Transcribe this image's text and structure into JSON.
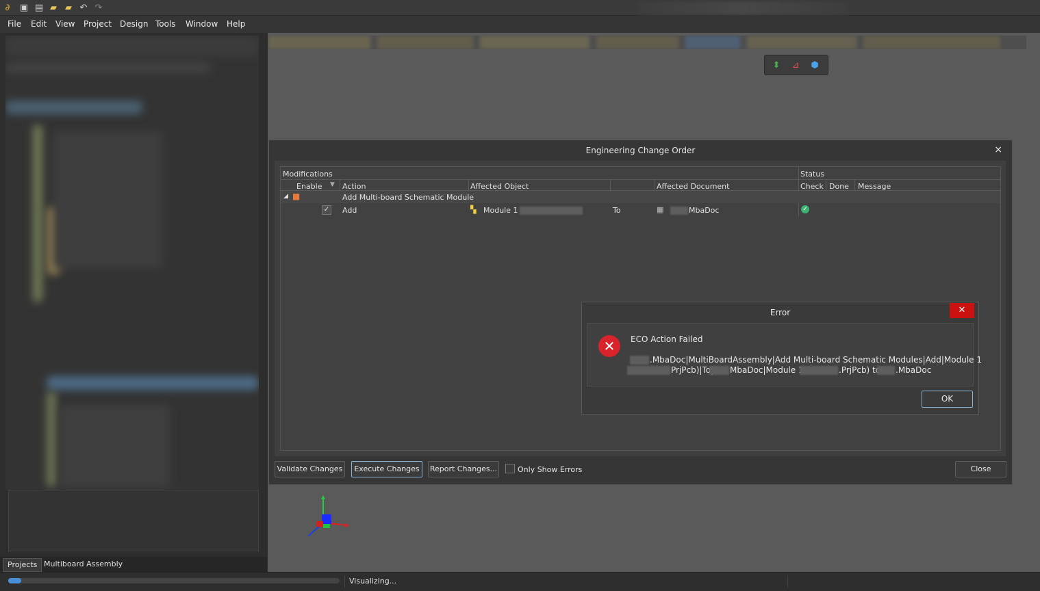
{
  "menu": [
    "File",
    "Edit",
    "View",
    "Project",
    "Design",
    "Tools",
    "Window",
    "Help"
  ],
  "left_tabs": [
    "Projects",
    "Multiboard Assembly"
  ],
  "eco": {
    "title": "Engineering Change Order",
    "close_glyph": "×",
    "group_modifications": "Modifications",
    "group_status": "Status",
    "columns": [
      "Enable",
      "Action",
      "Affected Object",
      "Affected Document",
      "Check",
      "Done",
      "Message"
    ],
    "group_row": {
      "label": "Add Multi-board Schematic Module"
    },
    "row": {
      "action": "Add",
      "object": "Module 1",
      "to": "To",
      "document": "MbaDoc"
    },
    "buttons": {
      "validate": "Validate Changes",
      "execute": "Execute Changes",
      "report": "Report Changes...",
      "close": "Close"
    },
    "only_show_errors": "Only Show Errors"
  },
  "error": {
    "title": "Error",
    "heading": "ECO Action Failed",
    "line1": ".MbaDoc|MultiBoardAssembly|Add Multi-board Schematic Modules|Add|Module 1",
    "line2_a": "PrjPcb)|To|",
    "line2_b": "MbaDoc|Module 1",
    "line2_c": ".PrjPcb) to",
    "line2_d": ".MbaDoc",
    "ok": "OK"
  },
  "status": {
    "text": "Visualizing...",
    "progress": 0.04
  },
  "colors": {
    "accent": "#4a8fd6",
    "error_red": "#d8232a",
    "check_green": "#3cb371"
  }
}
